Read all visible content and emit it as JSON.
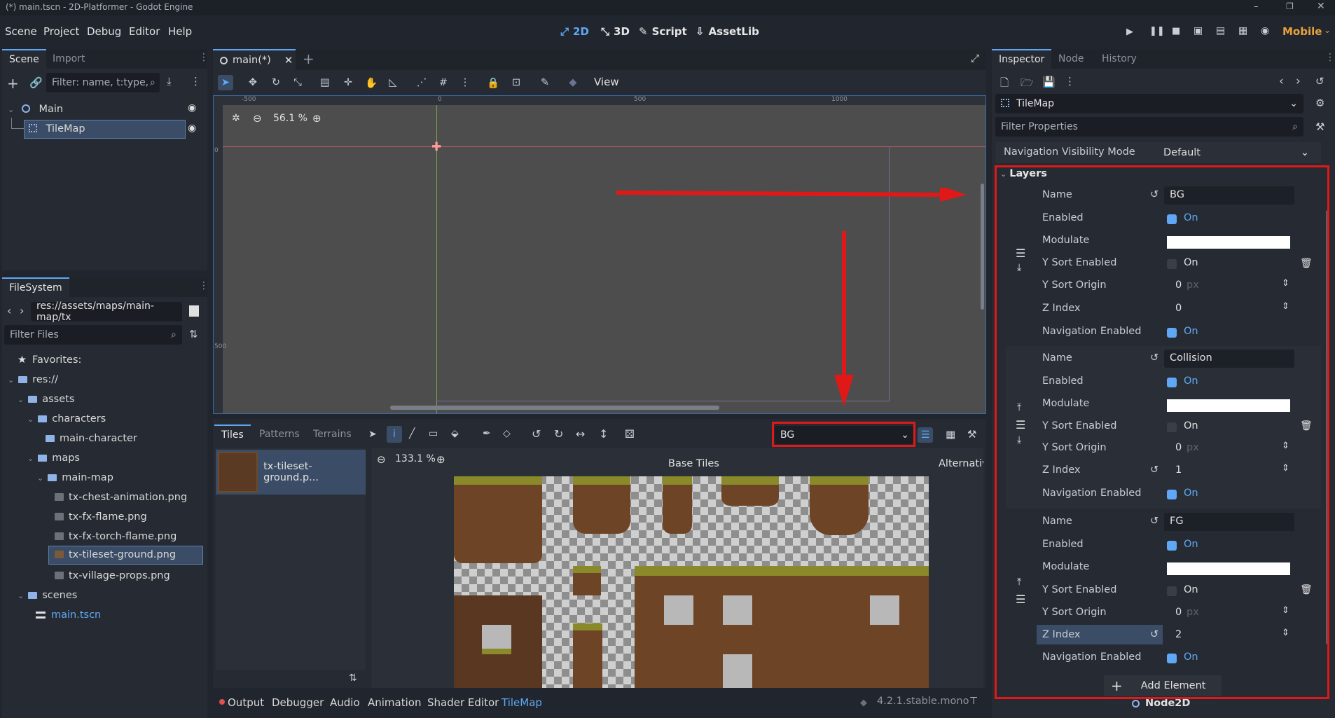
{
  "window": {
    "title": "(*) main.tscn - 2D-Platformer - Godot Engine"
  },
  "menu": [
    "Scene",
    "Project",
    "Debug",
    "Editor",
    "Help"
  ],
  "workspaces": {
    "w2d": "2D",
    "w3d": "3D",
    "script": "Script",
    "assetlib": "AssetLib"
  },
  "renderer": "Mobile",
  "scene_dock": {
    "tabs": [
      "Scene",
      "Import"
    ],
    "filter_placeholder": "Filter: name, t:type, g:gr",
    "nodes": [
      "Main",
      "TileMap"
    ]
  },
  "filesystem": {
    "title": "FileSystem",
    "path": "res://assets/maps/main-map/tx",
    "filter_placeholder": "Filter Files",
    "favorites": "Favorites:",
    "tree": [
      "res://",
      "assets",
      "characters",
      "main-character",
      "maps",
      "main-map",
      "tx-chest-animation.png",
      "tx-fx-flame.png",
      "tx-fx-torch-flame.png",
      "tx-tileset-ground.png",
      "tx-village-props.png",
      "scenes",
      "main.tscn"
    ]
  },
  "editor": {
    "tab": "main(*)",
    "view_menu": "View",
    "zoom": "56.1 %",
    "ruler_labels": [
      "-500",
      "0",
      "500",
      "1000"
    ],
    "vruler_labels": [
      "0",
      "500"
    ]
  },
  "tileset_panel": {
    "tabs": [
      "Tiles",
      "Patterns",
      "Terrains"
    ],
    "layer_select": "BG",
    "source": "tx-tileset-ground.p...",
    "zoom": "133.1 %",
    "base_tiles": "Base Tiles",
    "alternative": "Alternativ"
  },
  "bottom_bar": {
    "tabs": [
      "Output",
      "Debugger",
      "Audio",
      "Animation",
      "Shader Editor",
      "TileMap"
    ],
    "version": "4.2.1.stable.mono"
  },
  "inspector": {
    "tabs": [
      "Inspector",
      "Node",
      "History"
    ],
    "object": "TileMap",
    "filter_placeholder": "Filter Properties",
    "nav_visibility_label": "Navigation Visibility Mode",
    "nav_visibility_value": "Default",
    "layers_title": "Layers",
    "labels": {
      "name": "Name",
      "enabled": "Enabled",
      "modulate": "Modulate",
      "ysort_enabled": "Y Sort Enabled",
      "ysort_origin": "Y Sort Origin",
      "z_index": "Z Index",
      "nav_enabled": "Navigation Enabled"
    },
    "on_text": "On",
    "px_unit": "px",
    "layers": [
      {
        "name": "BG",
        "enabled": true,
        "modulate": "#ffffff",
        "ysort": false,
        "ysort_origin": "0",
        "z_index": "0",
        "nav": true
      },
      {
        "name": "Collision",
        "enabled": true,
        "modulate": "#ffffff",
        "ysort": false,
        "ysort_origin": "0",
        "z_index": "1",
        "nav": true
      },
      {
        "name": "FG",
        "enabled": true,
        "modulate": "#ffffff",
        "ysort": false,
        "ysort_origin": "0",
        "z_index": "2",
        "nav": true
      }
    ],
    "add_element": "Add Element",
    "footer": "Node2D"
  },
  "colors": {
    "accent": "#5fa8f5",
    "highlight": "#e01818"
  }
}
